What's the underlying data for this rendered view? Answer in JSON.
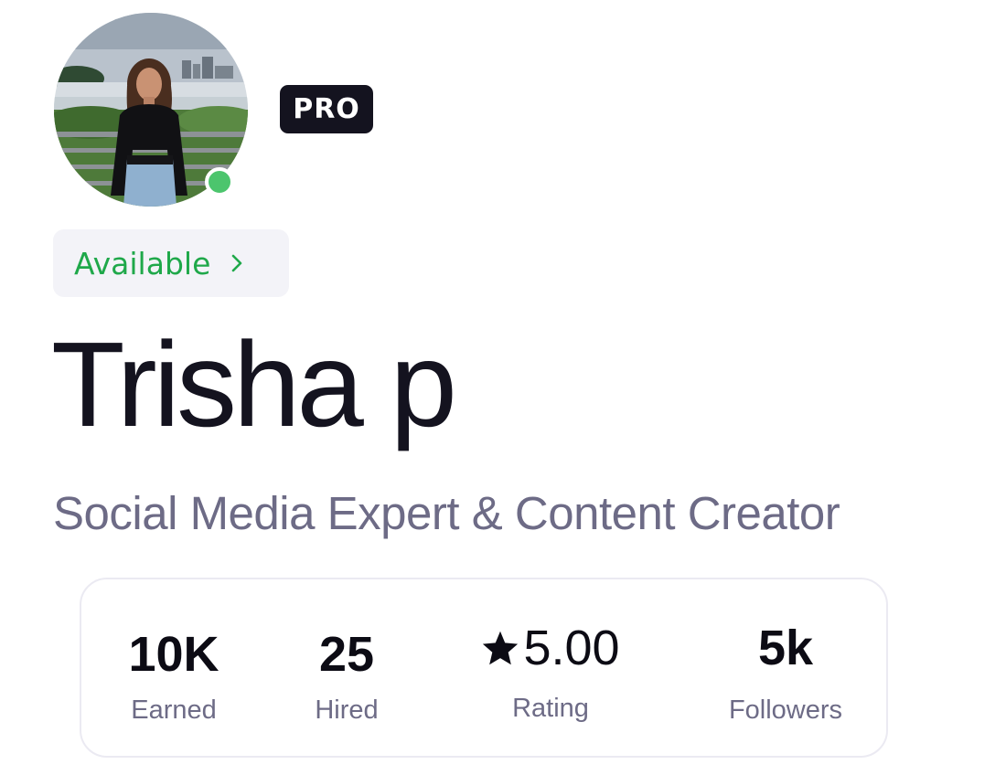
{
  "profile": {
    "badge": "PRO",
    "availability": "Available",
    "name": "Trisha p",
    "headline": "Social Media Expert & Content Creator"
  },
  "stats": {
    "earned": {
      "value": "10K",
      "label": "Earned"
    },
    "hired": {
      "value": "25",
      "label": "Hired"
    },
    "rating": {
      "value": "5.00",
      "label": "Rating"
    },
    "followers": {
      "value": "5k",
      "label": "Followers"
    }
  },
  "icons": {
    "status": "online-dot-icon",
    "availability": "chevron-right-icon",
    "rating": "star-icon"
  },
  "colors": {
    "online": "#4cc56d",
    "available_text": "#1fa84a",
    "badge_bg": "#14131f",
    "muted_text": "#6d6b86"
  }
}
